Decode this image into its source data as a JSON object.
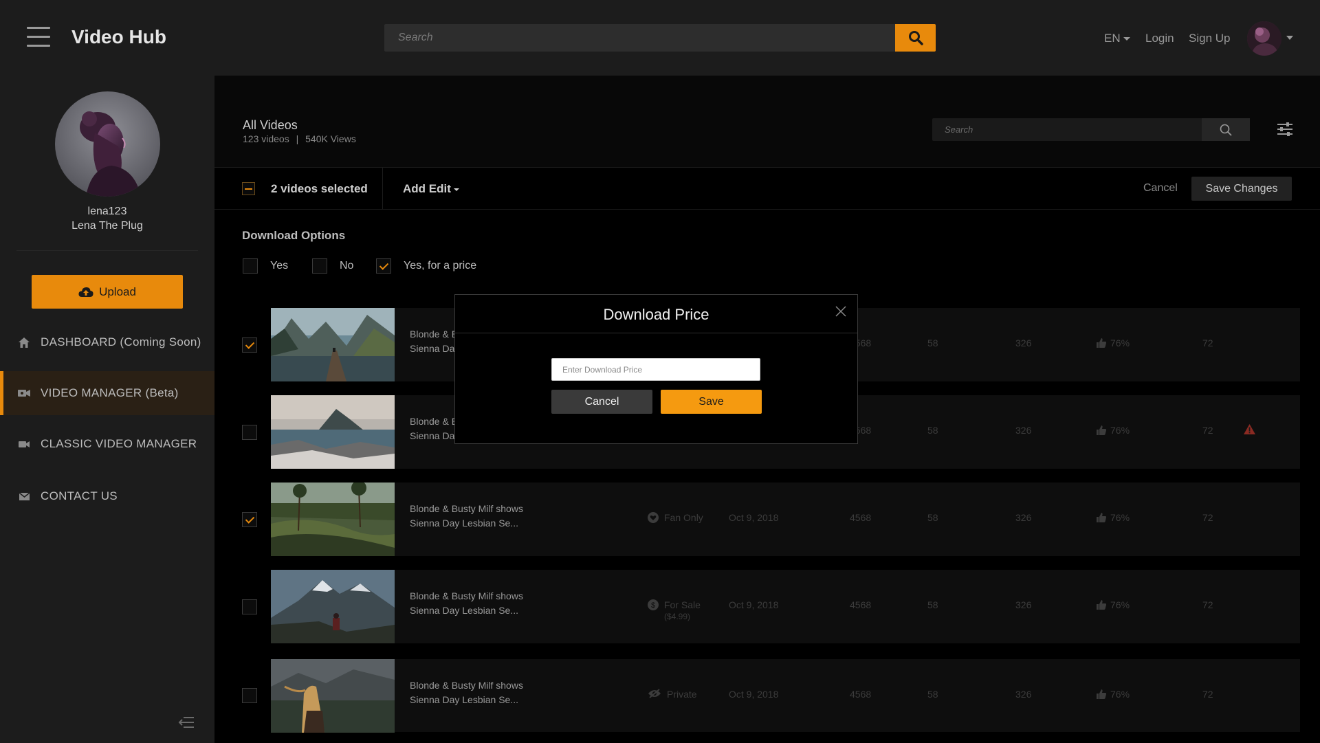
{
  "app": {
    "title": "Video Hub"
  },
  "topbar": {
    "search_placeholder": "Search",
    "lang": "EN",
    "login": "Login",
    "signup": "Sign Up"
  },
  "profile": {
    "username": "lena123",
    "display_name": "Lena The Plug"
  },
  "sidebar": {
    "upload_label": "Upload",
    "items": [
      {
        "label": "DASHBOARD (Coming Soon)",
        "icon": "home-icon"
      },
      {
        "label": "VIDEO MANAGER (Beta)",
        "icon": "video-manager-icon",
        "active": true
      },
      {
        "label": "CLASSIC VIDEO MANAGER",
        "icon": "video-camera-icon"
      },
      {
        "label": "CONTACT US",
        "icon": "envelope-icon"
      }
    ]
  },
  "main": {
    "title": "All Videos",
    "video_count": "123 videos",
    "separator": "|",
    "views": "540K Views",
    "search_placeholder": "Search"
  },
  "selection": {
    "label": "2 videos selected",
    "add_edit": "Add Edit",
    "cancel": "Cancel",
    "save_changes": "Save Changes"
  },
  "download_options": {
    "title": "Download Options",
    "options": [
      {
        "label": "Yes",
        "checked": false
      },
      {
        "label": "No",
        "checked": false
      },
      {
        "label": "Yes, for a price",
        "checked": true
      }
    ]
  },
  "rows": [
    {
      "title_1": "Blonde & E",
      "title_2": "Sienna Da",
      "status": "",
      "status_sub": "",
      "date": "",
      "views": "4568",
      "c1": "58",
      "c2": "326",
      "likes": "76%",
      "c3": "72",
      "checked": true,
      "warning": false
    },
    {
      "title_1": "Blonde & E",
      "title_2": "Sienna Da",
      "status": "",
      "status_sub": "",
      "date": "",
      "views": "4568",
      "c1": "58",
      "c2": "326",
      "likes": "76%",
      "c3": "72",
      "checked": false,
      "warning": true
    },
    {
      "title_1": "Blonde & Busty Milf shows",
      "title_2": "Sienna Day Lesbian Se...",
      "status": "Fan Only",
      "status_sub": "",
      "date": "Oct 9, 2018",
      "views": "4568",
      "c1": "58",
      "c2": "326",
      "likes": "76%",
      "c3": "72",
      "checked": true,
      "warning": false
    },
    {
      "title_1": "Blonde & Busty Milf shows",
      "title_2": "Sienna Day Lesbian Se...",
      "status": "For Sale",
      "status_sub": "($4.99)",
      "date": "Oct 9, 2018",
      "views": "4568",
      "c1": "58",
      "c2": "326",
      "likes": "76%",
      "c3": "72",
      "checked": false,
      "warning": false
    },
    {
      "title_1": "Blonde & Busty Milf shows",
      "title_2": "Sienna Day Lesbian Se...",
      "status": "Private",
      "status_sub": "",
      "date": "Oct 9, 2018",
      "views": "4568",
      "c1": "58",
      "c2": "326",
      "likes": "76%",
      "c3": "72",
      "checked": false,
      "warning": false
    }
  ],
  "modal": {
    "title": "Download Price",
    "input_placeholder": "Enter Download Price",
    "cancel": "Cancel",
    "save": "Save"
  },
  "colors": {
    "accent": "#e88a0c",
    "modal_save": "#f59a10",
    "warning": "#c0392b"
  }
}
